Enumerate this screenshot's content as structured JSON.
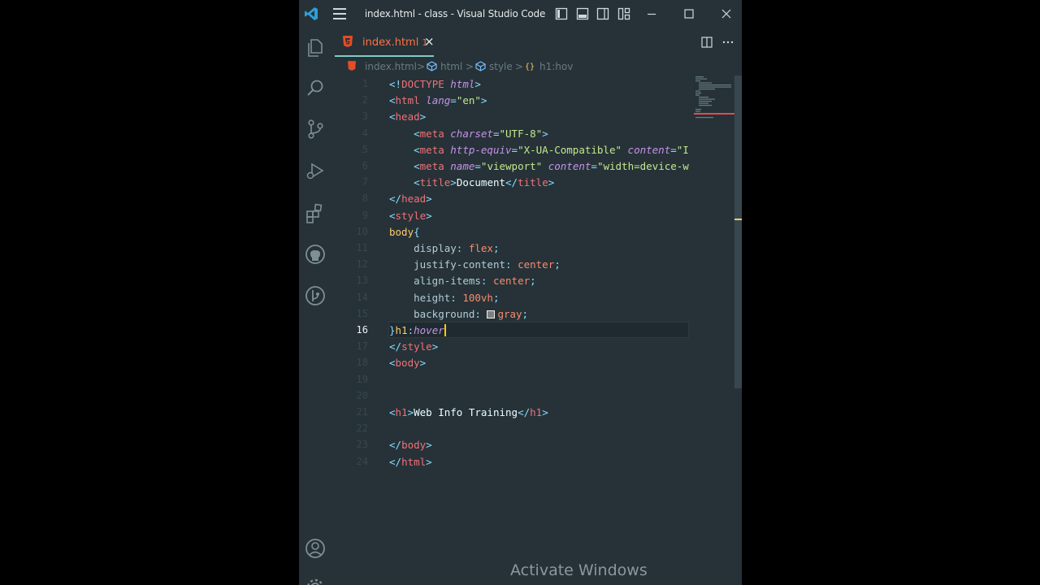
{
  "window": {
    "title": "index.html - class - Visual Studio Code"
  },
  "tab": {
    "name": "index.html",
    "problems_count": "1",
    "close_glyph": "×"
  },
  "breadcrumb": {
    "items": [
      "index.html",
      "html",
      "style",
      "h1:hov"
    ],
    "separator": ">"
  },
  "editor": {
    "line_numbers": [
      "1",
      "2",
      "3",
      "4",
      "5",
      "6",
      "7",
      "8",
      "9",
      "10",
      "11",
      "12",
      "13",
      "14",
      "15",
      "16",
      "17",
      "18",
      "19",
      "20",
      "21",
      "22",
      "23",
      "24"
    ],
    "current_line": "16",
    "lines": [
      [
        [
          "<!",
          "t-punct"
        ],
        [
          "DOCTYPE",
          "t-tag"
        ],
        [
          " ",
          "t-def"
        ],
        [
          "html",
          "t-attr"
        ],
        [
          ">",
          "t-punct"
        ]
      ],
      [
        [
          "<",
          "t-punct"
        ],
        [
          "html",
          "t-tag"
        ],
        [
          " ",
          "t-def"
        ],
        [
          "lang",
          "t-attr"
        ],
        [
          "=",
          "t-punct"
        ],
        [
          "\"en\"",
          "t-str"
        ],
        [
          ">",
          "t-punct"
        ]
      ],
      [
        [
          "<",
          "t-punct"
        ],
        [
          "head",
          "t-tag"
        ],
        [
          ">",
          "t-punct"
        ]
      ],
      [
        [
          "    ",
          "t-def"
        ],
        [
          "<",
          "t-punct"
        ],
        [
          "meta",
          "t-tag"
        ],
        [
          " ",
          "t-def"
        ],
        [
          "charset",
          "t-attr"
        ],
        [
          "=",
          "t-punct"
        ],
        [
          "\"UTF-8\"",
          "t-str"
        ],
        [
          ">",
          "t-punct"
        ]
      ],
      [
        [
          "    ",
          "t-def"
        ],
        [
          "<",
          "t-punct"
        ],
        [
          "meta",
          "t-tag"
        ],
        [
          " ",
          "t-def"
        ],
        [
          "http-equiv",
          "t-attr"
        ],
        [
          "=",
          "t-punct"
        ],
        [
          "\"X-UA-Compatible\"",
          "t-str"
        ],
        [
          " ",
          "t-def"
        ],
        [
          "content",
          "t-attr"
        ],
        [
          "=",
          "t-punct"
        ],
        [
          "\"I",
          "t-str"
        ]
      ],
      [
        [
          "    ",
          "t-def"
        ],
        [
          "<",
          "t-punct"
        ],
        [
          "meta",
          "t-tag"
        ],
        [
          " ",
          "t-def"
        ],
        [
          "name",
          "t-attr"
        ],
        [
          "=",
          "t-punct"
        ],
        [
          "\"viewport\"",
          "t-str"
        ],
        [
          " ",
          "t-def"
        ],
        [
          "content",
          "t-attr"
        ],
        [
          "=",
          "t-punct"
        ],
        [
          "\"width=device-w",
          "t-str"
        ]
      ],
      [
        [
          "    ",
          "t-def"
        ],
        [
          "<",
          "t-punct"
        ],
        [
          "title",
          "t-tag"
        ],
        [
          ">",
          "t-punct"
        ],
        [
          "Document",
          "t-def"
        ],
        [
          "</",
          "t-punct"
        ],
        [
          "title",
          "t-tag"
        ],
        [
          ">",
          "t-punct"
        ]
      ],
      [
        [
          "</",
          "t-punct"
        ],
        [
          "head",
          "t-tag"
        ],
        [
          ">",
          "t-punct"
        ]
      ],
      [
        [
          "<",
          "t-punct"
        ],
        [
          "style",
          "t-tag"
        ],
        [
          ">",
          "t-punct"
        ]
      ],
      [
        [
          "body",
          "t-sel"
        ],
        [
          "{",
          "t-punct"
        ]
      ],
      [
        [
          "    ",
          "t-def"
        ],
        [
          "display",
          "t-prop"
        ],
        [
          ": ",
          "t-punct"
        ],
        [
          "flex",
          "t-val"
        ],
        [
          ";",
          "t-punct"
        ]
      ],
      [
        [
          "    ",
          "t-def"
        ],
        [
          "justify-content",
          "t-prop"
        ],
        [
          ": ",
          "t-punct"
        ],
        [
          "center",
          "t-val"
        ],
        [
          ";",
          "t-punct"
        ]
      ],
      [
        [
          "    ",
          "t-def"
        ],
        [
          "align-items",
          "t-prop"
        ],
        [
          ": ",
          "t-punct"
        ],
        [
          "center",
          "t-val"
        ],
        [
          ";",
          "t-punct"
        ]
      ],
      [
        [
          "    ",
          "t-def"
        ],
        [
          "height",
          "t-prop"
        ],
        [
          ": ",
          "t-punct"
        ],
        [
          "100vh",
          "t-val"
        ],
        [
          ";",
          "t-punct"
        ]
      ],
      [
        [
          "    ",
          "t-def"
        ],
        [
          "background",
          "t-prop"
        ],
        [
          ": ",
          "t-punct"
        ],
        [
          "[swatch]",
          "t-swatch"
        ],
        [
          "gray",
          "t-val"
        ],
        [
          ";",
          "t-punct"
        ]
      ],
      [
        [
          "}",
          "t-punct"
        ],
        [
          "h1",
          "t-sel"
        ],
        [
          ":",
          "t-punct"
        ],
        [
          "hover",
          "t-pseudo"
        ],
        [
          "[caret]",
          "t-caret"
        ]
      ],
      [
        [
          "</",
          "t-punct"
        ],
        [
          "style",
          "t-tag"
        ],
        [
          ">",
          "t-punct"
        ]
      ],
      [
        [
          "<",
          "t-punct"
        ],
        [
          "body",
          "t-tag"
        ],
        [
          ">",
          "t-punct"
        ]
      ],
      [],
      [],
      [
        [
          "<",
          "t-punct"
        ],
        [
          "h1",
          "t-tag"
        ],
        [
          ">",
          "t-punct"
        ],
        [
          "Web Info Training",
          "t-def"
        ],
        [
          "</",
          "t-punct"
        ],
        [
          "h1",
          "t-tag"
        ],
        [
          ">",
          "t-punct"
        ]
      ],
      [],
      [
        [
          "</",
          "t-punct"
        ],
        [
          "body",
          "t-tag"
        ],
        [
          ">",
          "t-punct"
        ]
      ],
      [
        [
          "</",
          "t-punct"
        ],
        [
          "html",
          "t-tag"
        ],
        [
          ">",
          "t-punct"
        ]
      ]
    ]
  },
  "watermark": "Activate Windows",
  "colors": {
    "background": "#263238",
    "accent": "#80cbc4",
    "tab_label": "#ff7043"
  }
}
